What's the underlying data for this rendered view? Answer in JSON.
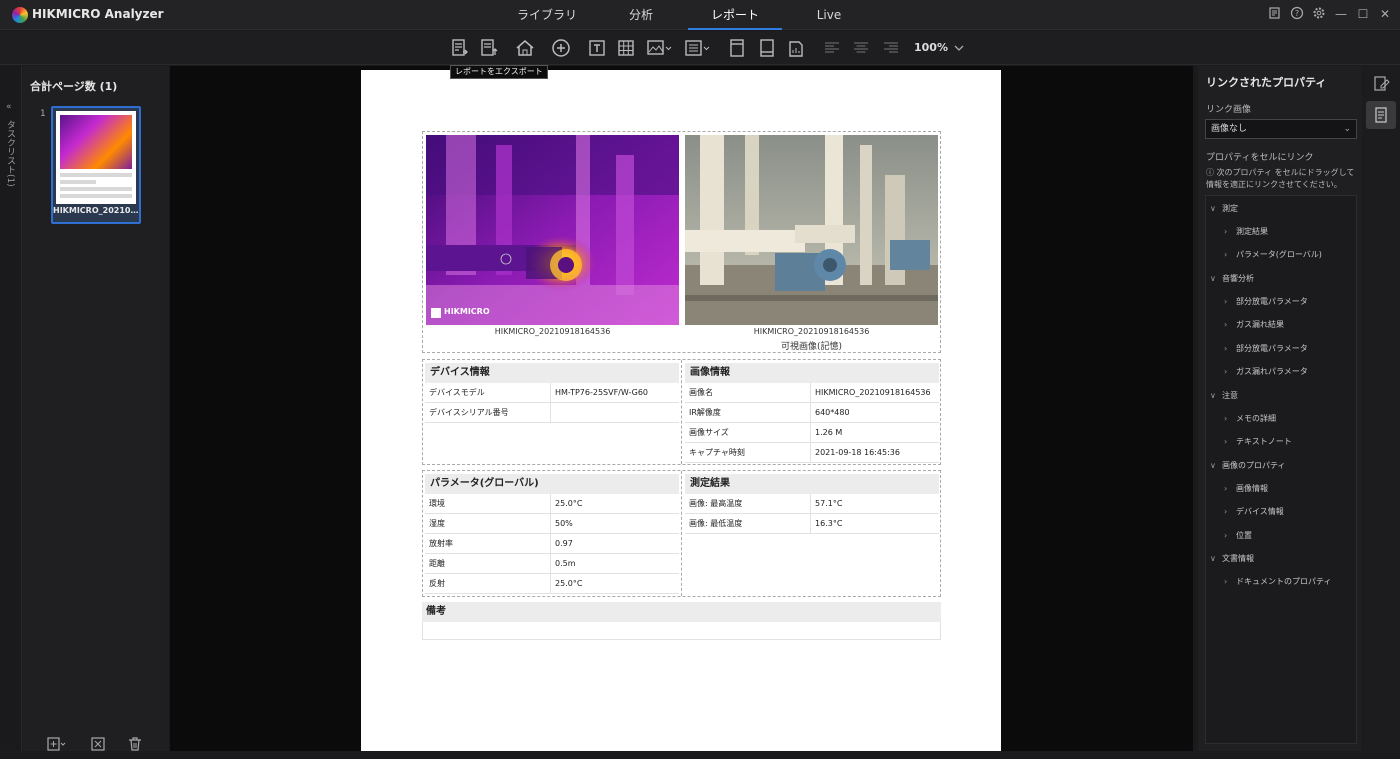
{
  "app": {
    "title": "HIKMICRO Analyzer"
  },
  "tabs": [
    {
      "label": "ライブラリ"
    },
    {
      "label": "分析"
    },
    {
      "label": "レポート",
      "active": true
    },
    {
      "label": "Live"
    }
  ],
  "toolbar": {
    "zoom": "100%",
    "tooltip": "レポートをエクスポート"
  },
  "side_tab": {
    "label": "タスクリスト(1)"
  },
  "left_panel": {
    "title": "合計ページ数 (1)",
    "page_number": "1",
    "thumb_name": "HIKMICRO_202109..."
  },
  "report": {
    "ir_caption": "HIKMICRO_20210918164536",
    "ir_logo": "HIKMICRO",
    "vis_caption": "HIKMICRO_20210918164536",
    "vis_subcaption": "可視画像(記憶)",
    "device": {
      "header": "デバイス情報",
      "rows": [
        {
          "k": "デバイスモデル",
          "v": "HM-TP76-25SVF/W-G60"
        },
        {
          "k": "デバイスシリアル番号",
          "v": ""
        }
      ]
    },
    "image": {
      "header": "画像情報",
      "rows": [
        {
          "k": "画像名",
          "v": "HIKMICRO_20210918164536"
        },
        {
          "k": "IR解像度",
          "v": "640*480"
        },
        {
          "k": "画像サイズ",
          "v": "1.26 M"
        },
        {
          "k": "キャプチャ時刻",
          "v": "2021-09-18 16:45:36"
        }
      ]
    },
    "params": {
      "header": "パラメータ(グローバル)",
      "rows": [
        {
          "k": "環境",
          "v": "25.0°C"
        },
        {
          "k": "湿度",
          "v": "50%"
        },
        {
          "k": "放射率",
          "v": "0.97"
        },
        {
          "k": "距離",
          "v": "0.5m"
        },
        {
          "k": "反射",
          "v": "25.0°C"
        }
      ]
    },
    "results": {
      "header": "測定結果",
      "rows": [
        {
          "k": "画像: 最高温度",
          "v": "57.1°C"
        },
        {
          "k": "画像: 最低温度",
          "v": "16.3°C"
        }
      ]
    },
    "notes_header": "備考"
  },
  "right_panel": {
    "title": "リンクされたプロパティ",
    "link_image_label": "リンク画像",
    "link_image_value": "画像なし",
    "link_props_label": "プロパティをセルにリンク",
    "hint": "ⓘ 次のプロパティ をセルにドラッグして情報を適正にリンクさせてください。",
    "tree": [
      {
        "label": "測定",
        "level": 0
      },
      {
        "label": "測定結果",
        "level": 1
      },
      {
        "label": "パラメータ(グローバル)",
        "level": 1
      },
      {
        "label": "音響分析",
        "level": 0
      },
      {
        "label": "部分放電パラメータ",
        "level": 1
      },
      {
        "label": "ガス漏れ結果",
        "level": 1
      },
      {
        "label": "部分放電パラメータ",
        "level": 1
      },
      {
        "label": "ガス漏れパラメータ",
        "level": 1
      },
      {
        "label": "注意",
        "level": 0
      },
      {
        "label": "メモの詳細",
        "level": 1
      },
      {
        "label": "テキストノート",
        "level": 1
      },
      {
        "label": "画像のプロパティ",
        "level": 0
      },
      {
        "label": "画像情報",
        "level": 1
      },
      {
        "label": "デバイス情報",
        "level": 1
      },
      {
        "label": "位置",
        "level": 1
      },
      {
        "label": "文書情報",
        "level": 0
      },
      {
        "label": "ドキュメントのプロパティ",
        "level": 1
      }
    ]
  }
}
